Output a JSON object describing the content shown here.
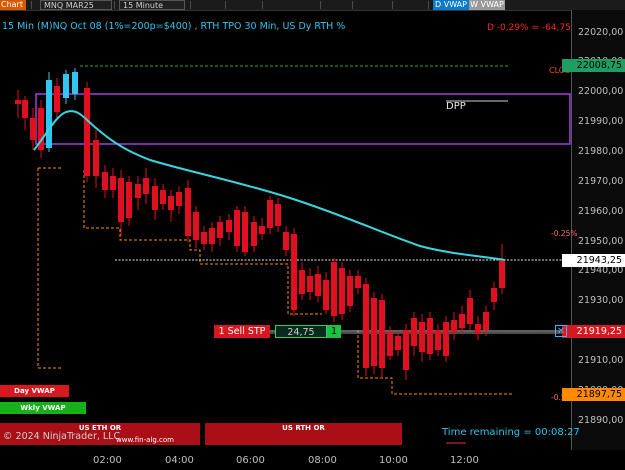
{
  "toolbar": {
    "chart_tab": "Chart",
    "instrument": "MNQ MAR25",
    "interval": "15 Minute",
    "day_vwap_button": "D VWAP",
    "weekly_vwap_button": "W VWAP"
  },
  "chart_title": "15 Min (M)NQ Oct 08 (1%=200p=$400) , RTH TPO 30 Min, US Dy RTH %",
  "pnl_text": "D -0,29% = -64,75",
  "price_axis": {
    "ticks": [
      "22020,00",
      "22010,00",
      "22000,00",
      "21990,00",
      "21980,00",
      "21970,00",
      "21960,00",
      "21950,00",
      "21940,00",
      "21930,00",
      "21920,00",
      "21910,00",
      "21900,00",
      "21890,00"
    ],
    "labels": {
      "current": "21943,25",
      "top": "22008,75",
      "order": "21919,25",
      "low": "21897,75"
    },
    "clos_label": "CLOS",
    "pct_top": "-0.25%",
    "pct_bottom": "-0.5%"
  },
  "time_axis": [
    "02:00",
    "04:00",
    "06:00",
    "08:00",
    "10:00",
    "12:00"
  ],
  "order": {
    "action": "1  Sell STP",
    "price": "24,75",
    "quantity": "1",
    "close_glyph": "✕"
  },
  "indicators": {
    "day_vwap": "Day VWAP",
    "weekly_vwap": "Wkly VWAP",
    "eth_or": "US ETH OR",
    "rth_or": "US RTH OR",
    "dpp": "DPP"
  },
  "footer": {
    "copyright": "© 2024 NinjaTrader, LLC",
    "website": "www.fin-alg.com",
    "time_remaining": "Time remaining = 00:08:27"
  },
  "colors": {
    "background": "#000000",
    "up_candle": "#2fc6f0",
    "down_candle": "#e01020",
    "vwap_line": "#3ad6e0",
    "dpp_box": "#a040e0",
    "orange_levels": "#ff8a00"
  }
}
